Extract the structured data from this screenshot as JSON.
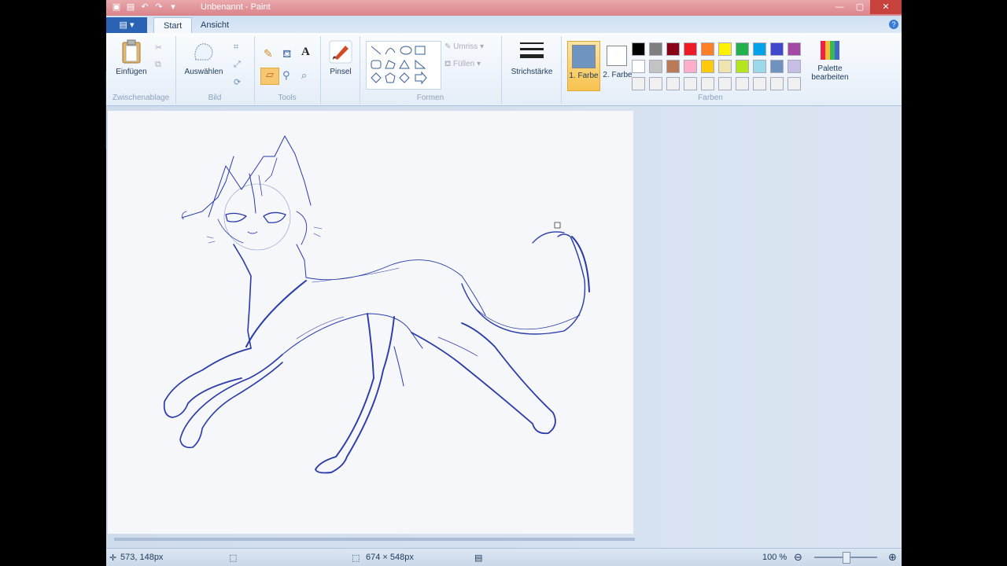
{
  "window": {
    "title": "Unbenannt - Paint"
  },
  "tabs": {
    "app_menu": "▾",
    "start": "Start",
    "view": "Ansicht"
  },
  "ribbon": {
    "clipboard": {
      "paste": "Einfügen",
      "label": "Zwischenablage"
    },
    "image": {
      "select": "Auswählen",
      "label": "Bild"
    },
    "tools": {
      "label": "Tools"
    },
    "brush": {
      "label": "Pinsel"
    },
    "shapes": {
      "outline": "Umriss",
      "fill": "Füllen",
      "label": "Formen"
    },
    "stroke": {
      "label": "Strichstärke"
    },
    "colors": {
      "color1": "1. Farbe",
      "color2": "2. Farbe",
      "color1_value": "#6f94c0",
      "color2_value": "#ffffff",
      "edit_palette": "Palette bearbeiten",
      "label": "Farben",
      "swatches": [
        "#000000",
        "#7f7f7f",
        "#880015",
        "#ed1c24",
        "#ff7f27",
        "#fff200",
        "#22b14c",
        "#00a2e8",
        "#3f48cc",
        "#a349a4",
        "#ffffff",
        "#c3c3c3",
        "#b97a57",
        "#ffaec9",
        "#ffc90e",
        "#efe4b0",
        "#b5e61d",
        "#99d9ea",
        "#7092be",
        "#c8bfe7",
        "#f0f0f0",
        "#f0f0f0",
        "#f0f0f0",
        "#f0f0f0",
        "#f0f0f0",
        "#f0f0f0",
        "#f0f0f0",
        "#f0f0f0",
        "#f0f0f0",
        "#f0f0f0"
      ]
    }
  },
  "status": {
    "cursor": "573, 148px",
    "size": "674 × 548px",
    "zoom": "100 %"
  },
  "colors": {
    "stroke": "#2a3aa8"
  }
}
